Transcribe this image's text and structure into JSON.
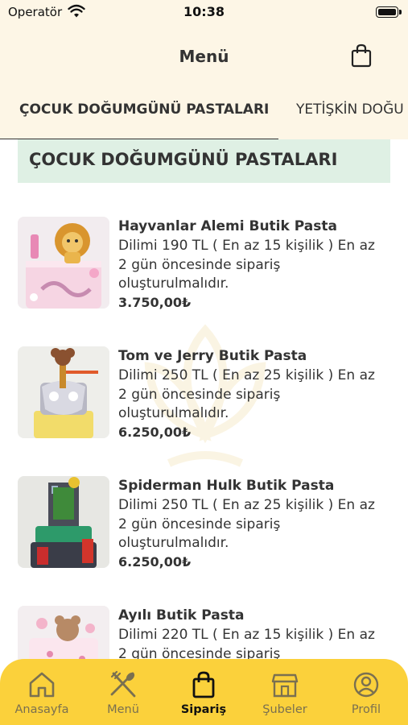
{
  "status_bar": {
    "carrier": "Operatör",
    "time": "10:38"
  },
  "header": {
    "title": "Menü",
    "cart_icon": "shopping-bag-icon"
  },
  "tabs": [
    {
      "label": "ÇOCUK DOĞUMGÜNÜ PASTALARI",
      "active": true
    },
    {
      "label": "YETİŞKİN DOĞU",
      "active": false
    }
  ],
  "section": {
    "title": "ÇOCUK DOĞUMGÜNÜ PASTALARI"
  },
  "products": [
    {
      "name": "Hayvanlar Alemi Butik Pasta",
      "description": "Dilimi 190 TL ( En az 15 kişilik ) En az 2 gün öncesinde sipariş oluşturulmalıdır.",
      "price": "3.750,00₺"
    },
    {
      "name": "Tom ve Jerry Butik Pasta",
      "description": "Dilimi 250 TL ( En az 25 kişilik ) En az 2 gün öncesinde sipariş oluşturulmalıdır.",
      "price": "6.250,00₺"
    },
    {
      "name": "Spiderman Hulk Butik Pasta",
      "description": "Dilimi 250 TL ( En az 25 kişilik ) En az 2 gün öncesinde sipariş oluşturulmalıdır.",
      "price": "6.250,00₺"
    },
    {
      "name": "Ayılı Butik Pasta",
      "description": "Dilimi 220 TL ( En az 15 kişilik ) En az 2 gün öncesinde sipariş",
      "price": ""
    }
  ],
  "tab_bar": [
    {
      "label": "Anasayfa",
      "icon": "home-icon",
      "active": false
    },
    {
      "label": "Menü",
      "icon": "fork-spoon-icon",
      "active": false
    },
    {
      "label": "Sipariş",
      "icon": "shopping-bag-icon",
      "active": true
    },
    {
      "label": "Şubeler",
      "icon": "store-icon",
      "active": false
    },
    {
      "label": "Profil",
      "icon": "profile-icon",
      "active": false
    }
  ],
  "colors": {
    "header_bg": "#fdf6e6",
    "section_bg": "#dff0e4",
    "tab_bar_bg": "#fbd13b"
  }
}
